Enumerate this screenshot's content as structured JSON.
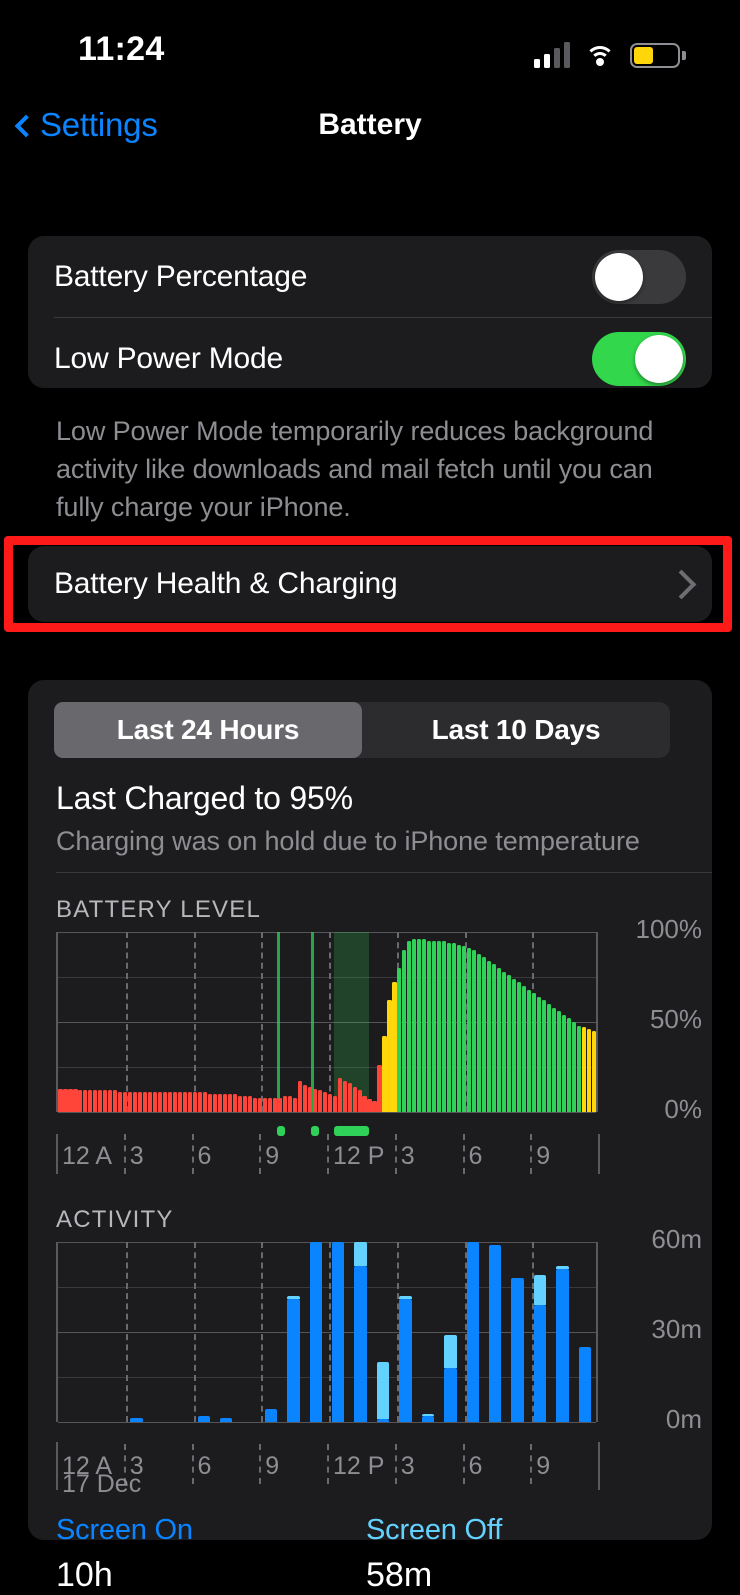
{
  "status_bar": {
    "time": "11:24",
    "signal_bars_filled": 2,
    "signal_bars_total": 4,
    "wifi": "wifi-icon",
    "battery_icon": "battery-icon",
    "battery_fill_pct": 45,
    "battery_color": "#ffd60a"
  },
  "nav": {
    "back_label": "Settings",
    "title": "Battery"
  },
  "settings": {
    "battery_percentage_label": "Battery Percentage",
    "battery_percentage_on": false,
    "low_power_mode_label": "Low Power Mode",
    "low_power_mode_on": true,
    "footnote": "Low Power Mode temporarily reduces background activity like downloads and mail fetch until you can fully charge your iPhone.",
    "battery_health_label": "Battery Health & Charging",
    "highlight_color": "#ff1a1a"
  },
  "usage": {
    "segments": [
      "Last 24 Hours",
      "Last 10 Days"
    ],
    "selected_segment": 0,
    "last_charged_title": "Last Charged to 95%",
    "last_charged_sub": "Charging was on hold due to iPhone temperature",
    "date_label": "17 Dec",
    "screen_on_label": "Screen On",
    "screen_on_value": "10h",
    "screen_off_label": "Screen Off",
    "screen_off_value": "58m",
    "screen_on_color": "#0a84ff",
    "screen_off_color": "#64d2ff"
  },
  "chart_data": [
    {
      "type": "bar",
      "title": "BATTERY LEVEL",
      "xlabel": "",
      "ylabel": "",
      "ylim": [
        0,
        100
      ],
      "yticks": [
        0,
        50,
        100
      ],
      "ytick_labels": [
        "0%",
        "50%",
        "100%"
      ],
      "xtick_labels": [
        "12 A",
        "3",
        "6",
        "9",
        "12 P",
        "3",
        "6",
        "9"
      ],
      "xtick_positions": [
        0,
        3,
        6,
        9,
        12,
        15,
        18,
        21
      ],
      "grid": true,
      "legend": "none",
      "colors": {
        "low": "#ff453a",
        "charging": "#ffd60a",
        "normal": "#30d158",
        "charge_band": "rgba(48,209,88,0.22)"
      },
      "bar_interval_minutes": 15,
      "values": [
        13,
        13,
        13,
        13,
        12,
        12,
        12,
        12,
        12,
        12,
        12,
        12,
        11,
        11,
        11,
        11,
        11,
        11,
        11,
        11,
        11,
        11,
        11,
        11,
        11,
        11,
        11,
        11,
        11,
        11,
        10,
        10,
        10,
        10,
        10,
        10,
        9,
        9,
        9,
        8,
        8,
        8,
        8,
        8,
        8,
        9,
        9,
        8,
        17,
        15,
        14,
        13,
        12,
        11,
        10,
        9,
        19,
        17,
        16,
        14,
        12,
        9,
        7,
        6,
        26,
        42,
        62,
        72,
        80,
        90,
        95,
        96,
        96,
        96,
        95,
        95,
        95,
        95,
        94,
        94,
        93,
        92,
        91,
        90,
        88,
        86,
        84,
        82,
        80,
        78,
        76,
        74,
        72,
        70,
        68,
        66,
        64,
        62,
        60,
        58,
        56,
        54,
        52,
        50,
        48,
        47,
        46,
        45
      ],
      "states": [
        "low",
        "low",
        "low",
        "low",
        "low",
        "low",
        "low",
        "low",
        "low",
        "low",
        "low",
        "low",
        "low",
        "low",
        "low",
        "low",
        "low",
        "low",
        "low",
        "low",
        "low",
        "low",
        "low",
        "low",
        "low",
        "low",
        "low",
        "low",
        "low",
        "low",
        "low",
        "low",
        "low",
        "low",
        "low",
        "low",
        "low",
        "low",
        "low",
        "low",
        "low",
        "low",
        "low",
        "low",
        "low",
        "low",
        "low",
        "low",
        "low",
        "low",
        "low",
        "low",
        "low",
        "low",
        "low",
        "low",
        "low",
        "low",
        "low",
        "low",
        "low",
        "low",
        "low",
        "low",
        "low",
        "charging",
        "charging",
        "charging",
        "normal",
        "normal",
        "normal",
        "normal",
        "normal",
        "normal",
        "normal",
        "normal",
        "normal",
        "normal",
        "normal",
        "normal",
        "normal",
        "normal",
        "normal",
        "normal",
        "normal",
        "normal",
        "normal",
        "normal",
        "normal",
        "normal",
        "normal",
        "normal",
        "normal",
        "normal",
        "normal",
        "normal",
        "normal",
        "normal",
        "normal",
        "normal",
        "normal",
        "normal",
        "normal",
        "normal",
        "normal",
        "charging",
        "charging",
        "charging"
      ],
      "charging_sessions": [
        {
          "start_hour": 9.7,
          "end_hour": 9.78,
          "type": "brief"
        },
        {
          "start_hour": 11.2,
          "end_hour": 11.28,
          "type": "brief"
        },
        {
          "start_hour": 12.2,
          "end_hour": 13.75,
          "type": "band"
        }
      ]
    },
    {
      "type": "bar",
      "title": "ACTIVITY",
      "xlabel": "",
      "ylabel": "",
      "ylim": [
        0,
        60
      ],
      "yticks": [
        0,
        30,
        60
      ],
      "ytick_labels": [
        "0m",
        "30m",
        "60m"
      ],
      "xtick_labels": [
        "12 A",
        "3",
        "6",
        "9",
        "12 P",
        "3",
        "6",
        "9"
      ],
      "xtick_positions": [
        0,
        3,
        6,
        9,
        12,
        15,
        18,
        21
      ],
      "grid": true,
      "legend": "none",
      "stacked": true,
      "bar_interval_minutes": 60,
      "series": [
        {
          "name": "Screen On",
          "color": "#0a84ff",
          "values": [
            0,
            0,
            0,
            1.5,
            0,
            0,
            2,
            1.2,
            0,
            4.5,
            41,
            60,
            60,
            52,
            1,
            41,
            2,
            18,
            60,
            59,
            48,
            39,
            51,
            25
          ]
        },
        {
          "name": "Screen Off",
          "color": "#64d2ff",
          "values": [
            0,
            0,
            0,
            0,
            0,
            0,
            0,
            0,
            0,
            0,
            1,
            0,
            0,
            8,
            19,
            1,
            0.8,
            11,
            0,
            0,
            0,
            10,
            1,
            0
          ]
        }
      ]
    }
  ]
}
